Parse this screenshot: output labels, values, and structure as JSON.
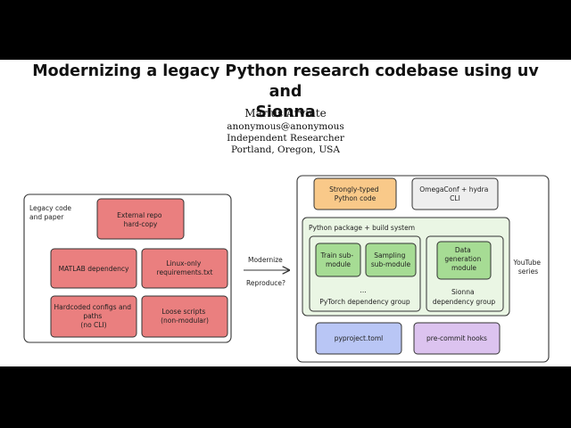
{
  "paper": {
    "title_line1": "Modernizing a legacy Python research codebase using uv and",
    "title_line2": "Sionna",
    "author": "Marius Arvinte",
    "email": "anonymous@anonymous",
    "affiliation": "Independent Researcher",
    "location": "Portland, Oregon, USA"
  },
  "diagram": {
    "legacy_label": [
      "Legacy code",
      "and paper"
    ],
    "external_repo": [
      "External repo",
      "hard-copy"
    ],
    "matlab": [
      "MATLAB dependency"
    ],
    "linux": [
      "Linux-only",
      "requirements.txt"
    ],
    "hardcoded": [
      "Hardcoded configs and",
      "paths",
      "(no CLI)"
    ],
    "loose": [
      "Loose scripts",
      "(non-modular)"
    ],
    "modernize": "Modernize",
    "reproduce": "Reproduce?",
    "typed": [
      "Strongly-typed",
      "Python code"
    ],
    "omegaconf": [
      "OmegaConf + hydra",
      "CLI"
    ],
    "package": "Python package + build system",
    "train": [
      "Train sub-",
      "module"
    ],
    "sampling": [
      "Sampling",
      "sub-module"
    ],
    "ellipsis": "...",
    "pytorch": "PyTorch dependency group",
    "datagen": [
      "Data",
      "generation",
      "module"
    ],
    "sionna": [
      "Sionna",
      "dependency group"
    ],
    "youtube": [
      "YouTube",
      "series"
    ],
    "pyproject": [
      "pyproject.toml"
    ],
    "precommit": [
      "pre-commit hooks"
    ]
  }
}
